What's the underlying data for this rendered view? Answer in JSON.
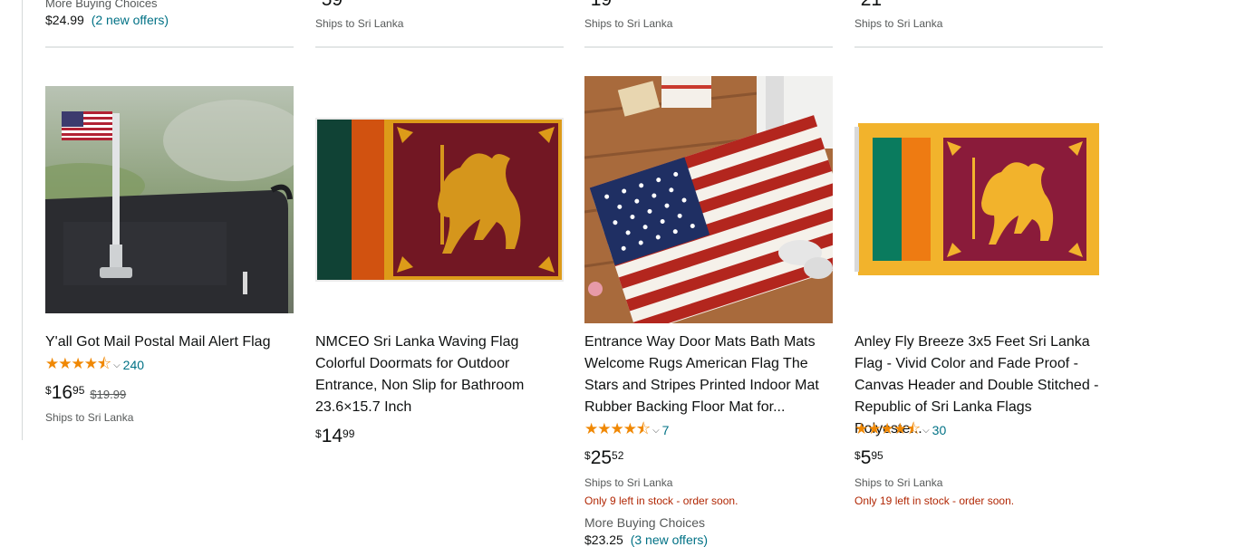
{
  "top_row": {
    "col1": {
      "more_buying": "More Buying Choices",
      "price": "$24.99",
      "offers": "(2 new offers)"
    },
    "col2": {
      "price_partial": "59",
      "ships": "Ships to Sri Lanka"
    },
    "col3": {
      "price_partial": "19",
      "ships": "Ships to Sri Lanka"
    },
    "col4": {
      "price_partial": "21",
      "ships": "Ships to Sri Lanka"
    }
  },
  "products": [
    {
      "title": "Y'all Got Mail Postal Mail Alert Flag",
      "rating": 4.5,
      "stars": "★★★★⯪",
      "rating_count": "240",
      "price_symbol": "$",
      "price_whole": "16",
      "price_fraction": "95",
      "list_price": "$19.99",
      "ships": "Ships to Sri Lanka"
    },
    {
      "title": "NMCEO Sri Lanka Waving Flag Colorful Doormats for Outdoor Entrance, Non Slip for Bathroom 23.6×15.7 Inch",
      "price_symbol": "$",
      "price_whole": "14",
      "price_fraction": "99"
    },
    {
      "title": "Entrance Way Door Mats Bath Mats Welcome Rugs American Flag The Stars and Stripes Printed Indoor Mat Rubber Backing Floor Mat for...",
      "rating": 4.5,
      "stars": "★★★★⯪",
      "rating_count": "7",
      "price_symbol": "$",
      "price_whole": "25",
      "price_fraction": "52",
      "ships": "Ships to Sri Lanka",
      "stock": "Only 9 left in stock - order soon.",
      "more_buying": "More Buying Choices",
      "more_price": "$23.25",
      "more_offers": "(3 new offers)"
    },
    {
      "title": "Anley Fly Breeze 3x5 Feet Sri Lanka Flag - Vivid Color and Fade Proof - Canvas Header and Double Stitched - Republic of Sri Lanka Flags Polyeste...",
      "rating": 4.5,
      "stars": "★★★★⯪",
      "rating_count": "30",
      "price_symbol": "$",
      "price_whole": "5",
      "price_fraction": "95",
      "ships": "Ships to Sri Lanka",
      "stock": "Only 19 left in stock - order soon."
    }
  ],
  "icons": {
    "star": "star-icon",
    "chevron": "chevron-down-icon"
  },
  "colors": {
    "star": "#f08804",
    "link": "#007185",
    "stock_warning": "#b12704",
    "text": "#0f1111",
    "muted": "#565959"
  }
}
